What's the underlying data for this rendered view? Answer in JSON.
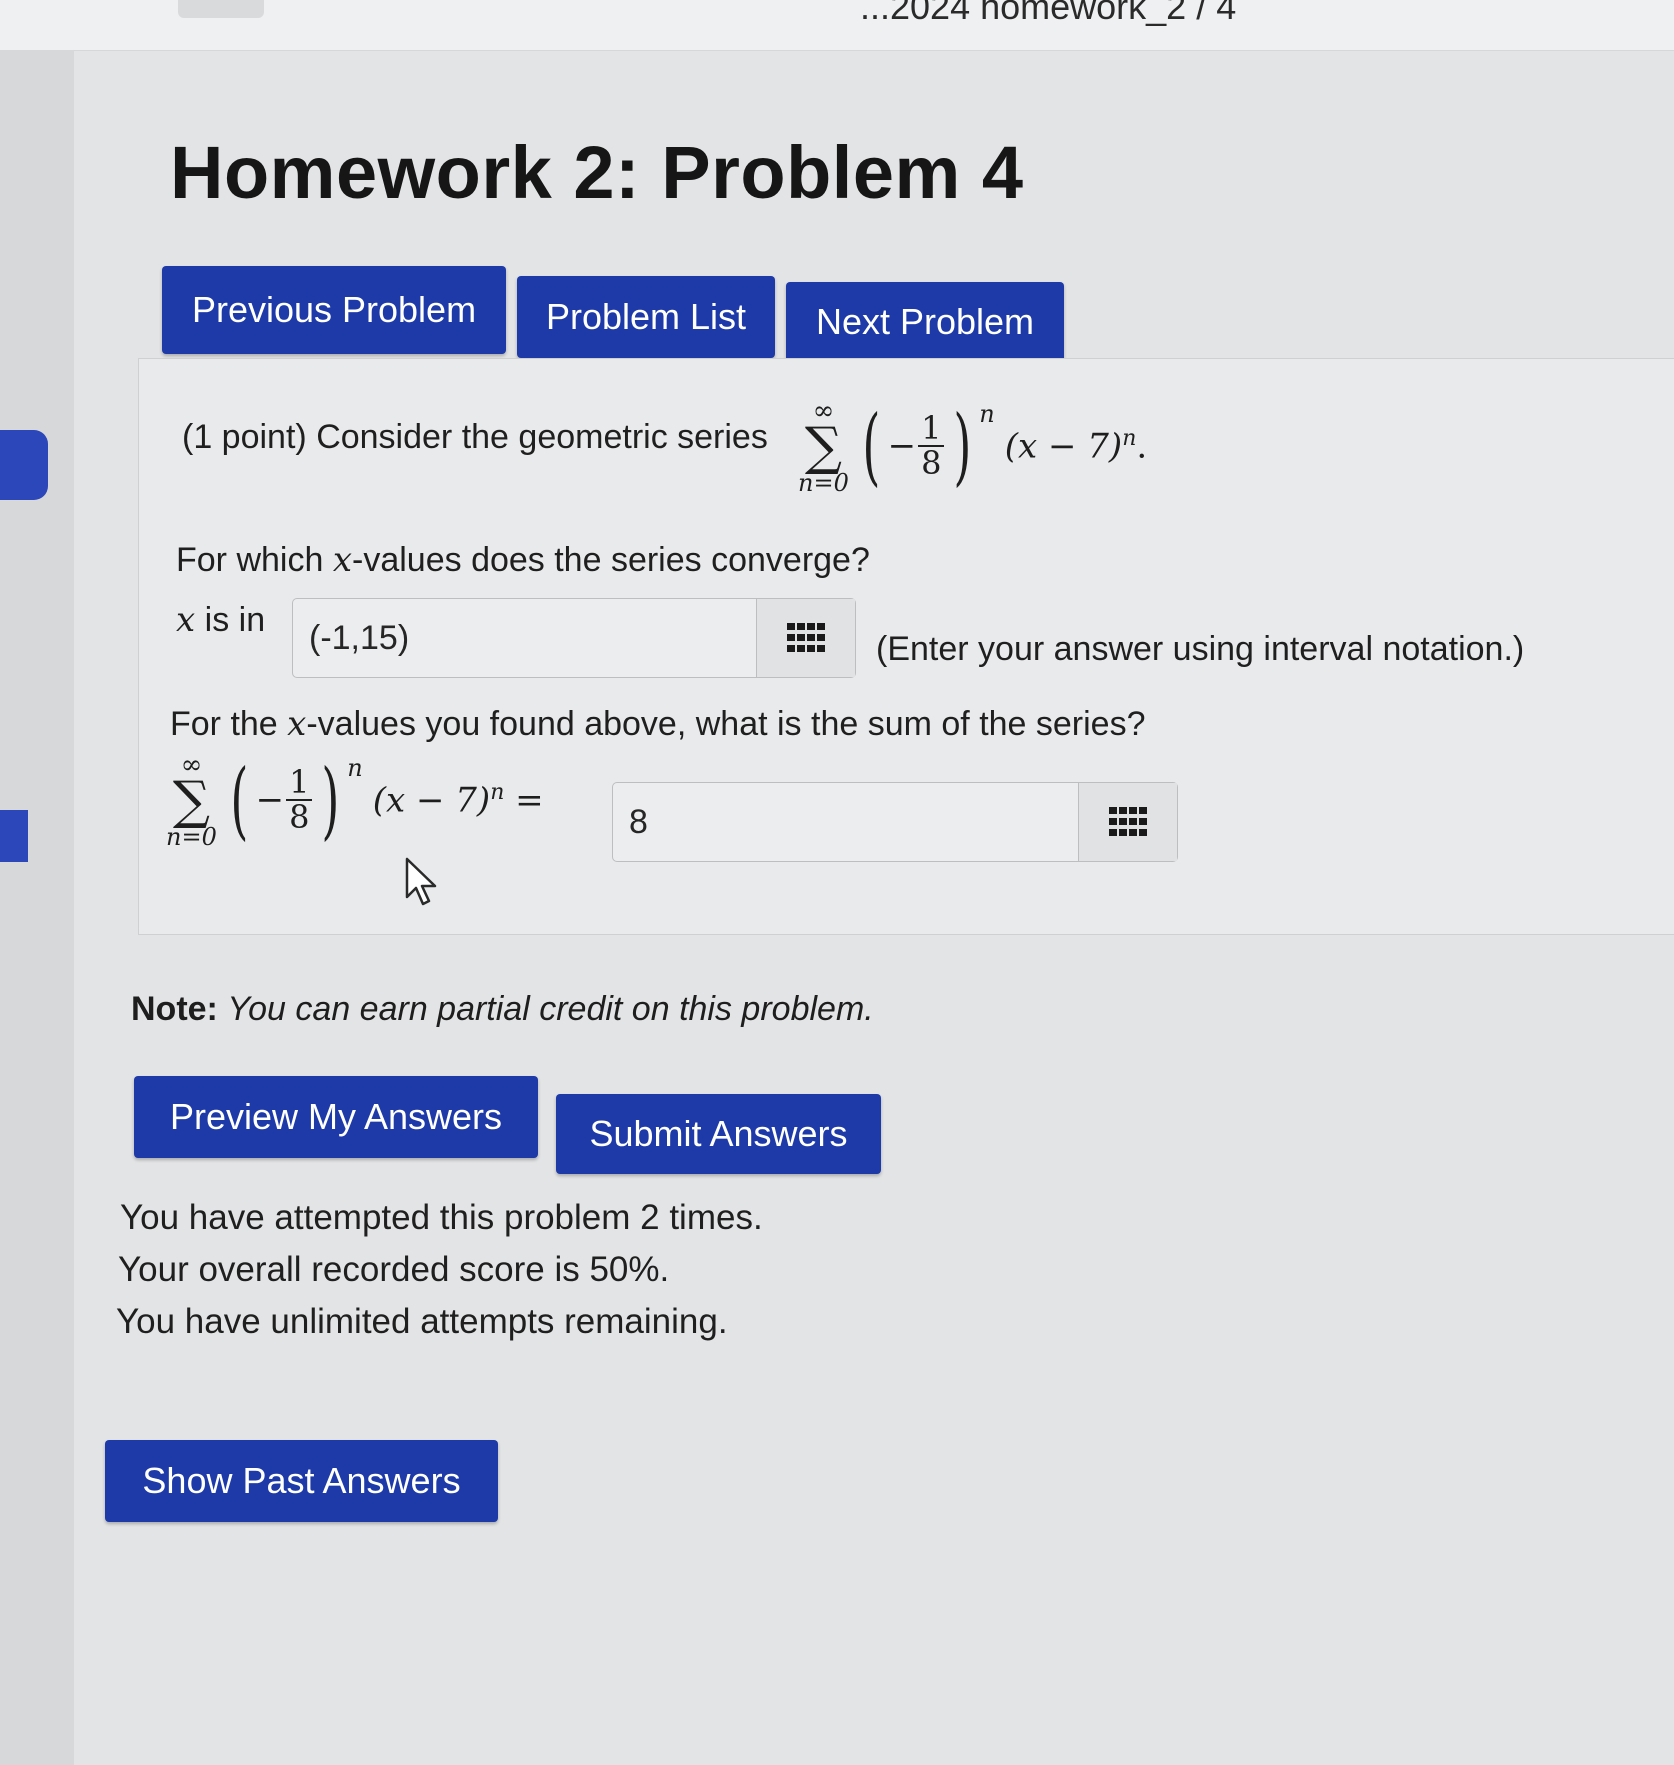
{
  "browser": {
    "tab_title": "...2024 homework_2 / 4"
  },
  "header": {
    "title": "Homework 2: Problem 4"
  },
  "nav": {
    "previous_label": "Previous Problem",
    "list_label": "Problem List",
    "next_label": "Next Problem"
  },
  "problem": {
    "points": "(1 point)",
    "intro": "Consider the geometric series",
    "series": {
      "upper": "∞",
      "lower": "n=0",
      "numerator": "1",
      "denominator": "8",
      "exponent": "n",
      "term": "(x − 7)",
      "term_exp": "n"
    },
    "q1_prefix": "For which ",
    "q1_var": "x",
    "q1_suffix": "-values does the series converge?",
    "x_label_var": "x",
    "x_label_text": " is in",
    "answer1_value": "(-1,15)",
    "answer1_hint": "(Enter your answer using interval notation.)",
    "q2_prefix": "For the ",
    "q2_var": "x",
    "q2_suffix": "-values you found above, what is the sum of the series?",
    "answer2_value": "8"
  },
  "note": {
    "label": "Note:",
    "text": "You can earn partial credit on this problem."
  },
  "actions": {
    "preview_label": "Preview My Answers",
    "submit_label": "Submit Answers",
    "past_label": "Show Past Answers"
  },
  "status": {
    "attempts": "You have attempted this problem 2 times.",
    "score": "Your overall recorded score is 50%.",
    "remaining": "You have unlimited attempts remaining."
  },
  "colors": {
    "button_blue": "#1d3aa8",
    "background": "#e3e4e6",
    "panel": "#e9eaec"
  },
  "icons": [
    "grid-icon",
    "cursor-arrow-icon"
  ]
}
